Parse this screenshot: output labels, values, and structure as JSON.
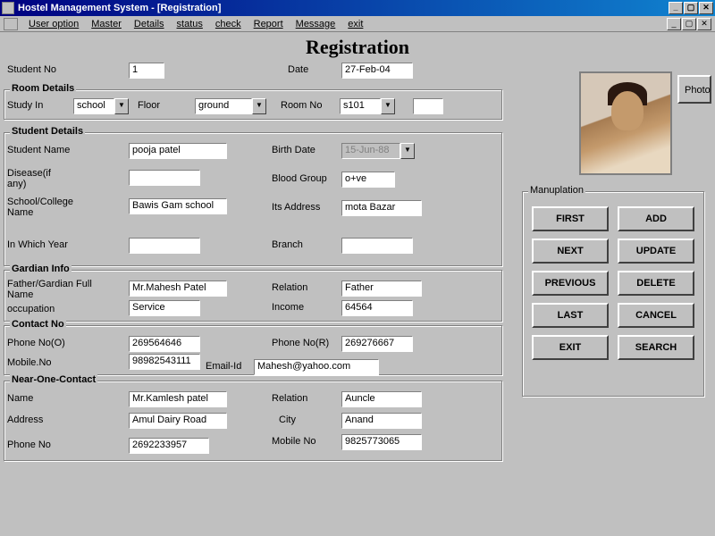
{
  "window": {
    "title": "Hostel Management System - [Registration]"
  },
  "menu": {
    "items": [
      "User option",
      "Master",
      "Details",
      "status",
      "check",
      "Report",
      "Message",
      "exit"
    ]
  },
  "page": {
    "heading": "Registration"
  },
  "labels": {
    "student_no": "Student No",
    "date": "Date",
    "room_details": "Room Details",
    "study_in": "Study In",
    "floor": "Floor",
    "room_no": "Room No",
    "student_details": "Student Details",
    "student_name": "Student Name",
    "birth_date": "Birth Date",
    "disease": "Disease(if any)",
    "blood_group": "Blood Group",
    "school_college": "School/College Name",
    "its_address": "Its Address",
    "in_which_year": "In Which Year",
    "branch": "Branch",
    "guardian_info": "Gardian Info",
    "guardian_name": "Father/Gardian Full Name",
    "relation": "Relation",
    "occupation": "occupation",
    "income": "Income",
    "contact_no": "Contact No",
    "phone_o": "Phone No(O)",
    "phone_r": "Phone No(R)",
    "mobile_no": "Mobile.No",
    "email_id": "Email-Id",
    "near_one": "Near-One-Contact",
    "name": "Name",
    "address": "Address",
    "city": "City",
    "mobile_no2": "Mobile No",
    "phone_no": "Phone No",
    "photo": "Photo",
    "manipulation": "Manuplation"
  },
  "values": {
    "student_no": "1",
    "date": "27-Feb-04",
    "study_in": "school",
    "floor": "ground",
    "room_no": "s101",
    "extra_room": "",
    "student_name": "pooja patel",
    "birth_date": "15-Jun-88",
    "disease": "",
    "blood_group": "o+ve",
    "school_college": "Bawis Gam school",
    "its_address": "mota Bazar",
    "in_which_year": "",
    "branch": "",
    "guardian_name": "Mr.Mahesh Patel",
    "relation": "Father",
    "occupation": "Service",
    "income": "64564",
    "phone_o": "269564646",
    "phone_r": "269276667",
    "mobile_no": "98982543111",
    "email_id": "Mahesh@yahoo.com",
    "near_name": "Mr.Kamlesh patel",
    "near_relation": "Auncle",
    "near_address": "Amul Dairy Road",
    "near_city": "Anand",
    "near_phone": "2692233957",
    "near_mobile": "9825773065"
  },
  "buttons": {
    "first": "FIRST",
    "add": "ADD",
    "next": "NEXT",
    "update": "UPDATE",
    "previous": "PREVIOUS",
    "delete": "DELETE",
    "last": "LAST",
    "cancel": "CANCEL",
    "exit": "EXIT",
    "search": "SEARCH"
  }
}
